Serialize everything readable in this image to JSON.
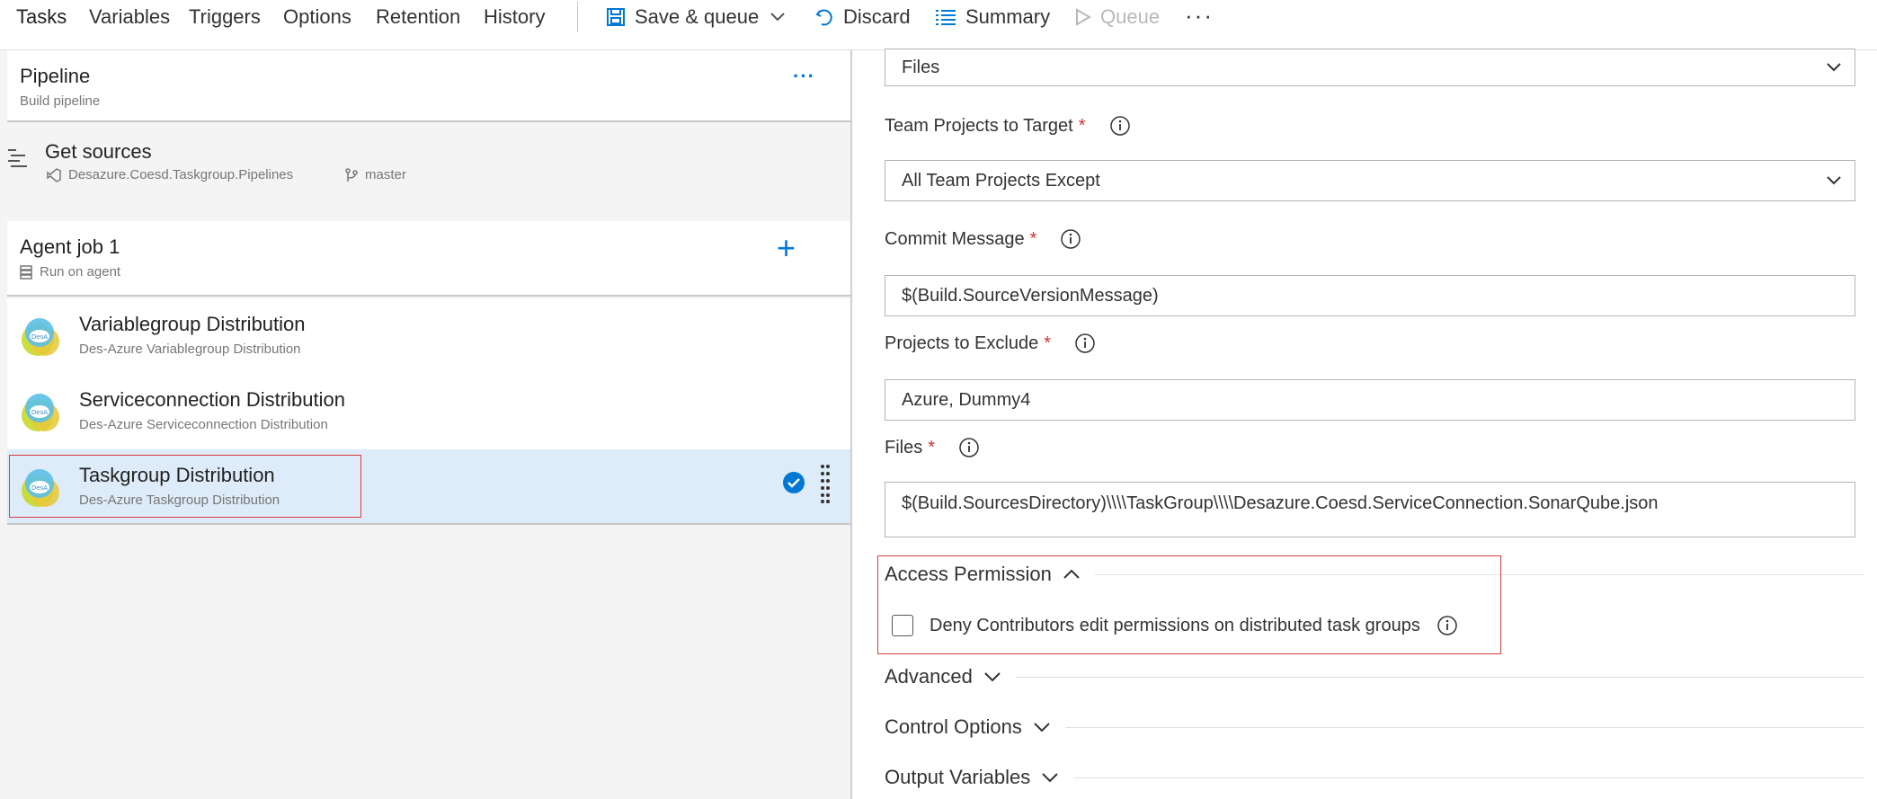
{
  "toolbar": {
    "tabs": [
      "Tasks",
      "Variables",
      "Triggers",
      "Options",
      "Retention",
      "History"
    ],
    "save_queue": "Save & queue",
    "discard": "Discard",
    "summary": "Summary",
    "queue": "Queue",
    "more": "···"
  },
  "pipeline": {
    "title": "Pipeline",
    "subtitle": "Build pipeline",
    "menu": "···"
  },
  "get_sources": {
    "title": "Get sources",
    "repo": "Desazure.Coesd.Taskgroup.Pipelines",
    "branch": "master"
  },
  "agent_job": {
    "title": "Agent job 1",
    "subtitle": "Run on agent",
    "add": "+"
  },
  "tasks": [
    {
      "title": "Variablegroup Distribution",
      "subtitle": "Des-Azure Variablegroup Distribution"
    },
    {
      "title": "Serviceconnection Distribution",
      "subtitle": "Des-Azure Serviceconnection Distribution"
    },
    {
      "title": "Taskgroup Distribution",
      "subtitle": "Des-Azure Taskgroup Distribution",
      "selected": true
    }
  ],
  "form": {
    "top_dropdown_value": "Files",
    "team_projects": {
      "label": "Team Projects to Target",
      "value": "All Team Projects Except"
    },
    "commit_message": {
      "label": "Commit Message",
      "value": "$(Build.SourceVersionMessage)"
    },
    "projects_exclude": {
      "label": "Projects to Exclude",
      "value": "Azure, Dummy4"
    },
    "files": {
      "label": "Files",
      "value": "$(Build.SourcesDirectory)\\\\\\\\TaskGroup\\\\\\\\Desazure.Coesd.ServiceConnection.SonarQube.json"
    },
    "required_mark": "*"
  },
  "sections": {
    "access_permission": "Access Permission",
    "deny_contributors": "Deny Contributors edit permissions on distributed task groups",
    "advanced": "Advanced",
    "control_options": "Control Options",
    "output_variables": "Output Variables"
  },
  "colors": {
    "accent": "#0078d4",
    "selected_row": "#deebf8",
    "required": "#d13438",
    "highlight": "#d93f3f"
  }
}
